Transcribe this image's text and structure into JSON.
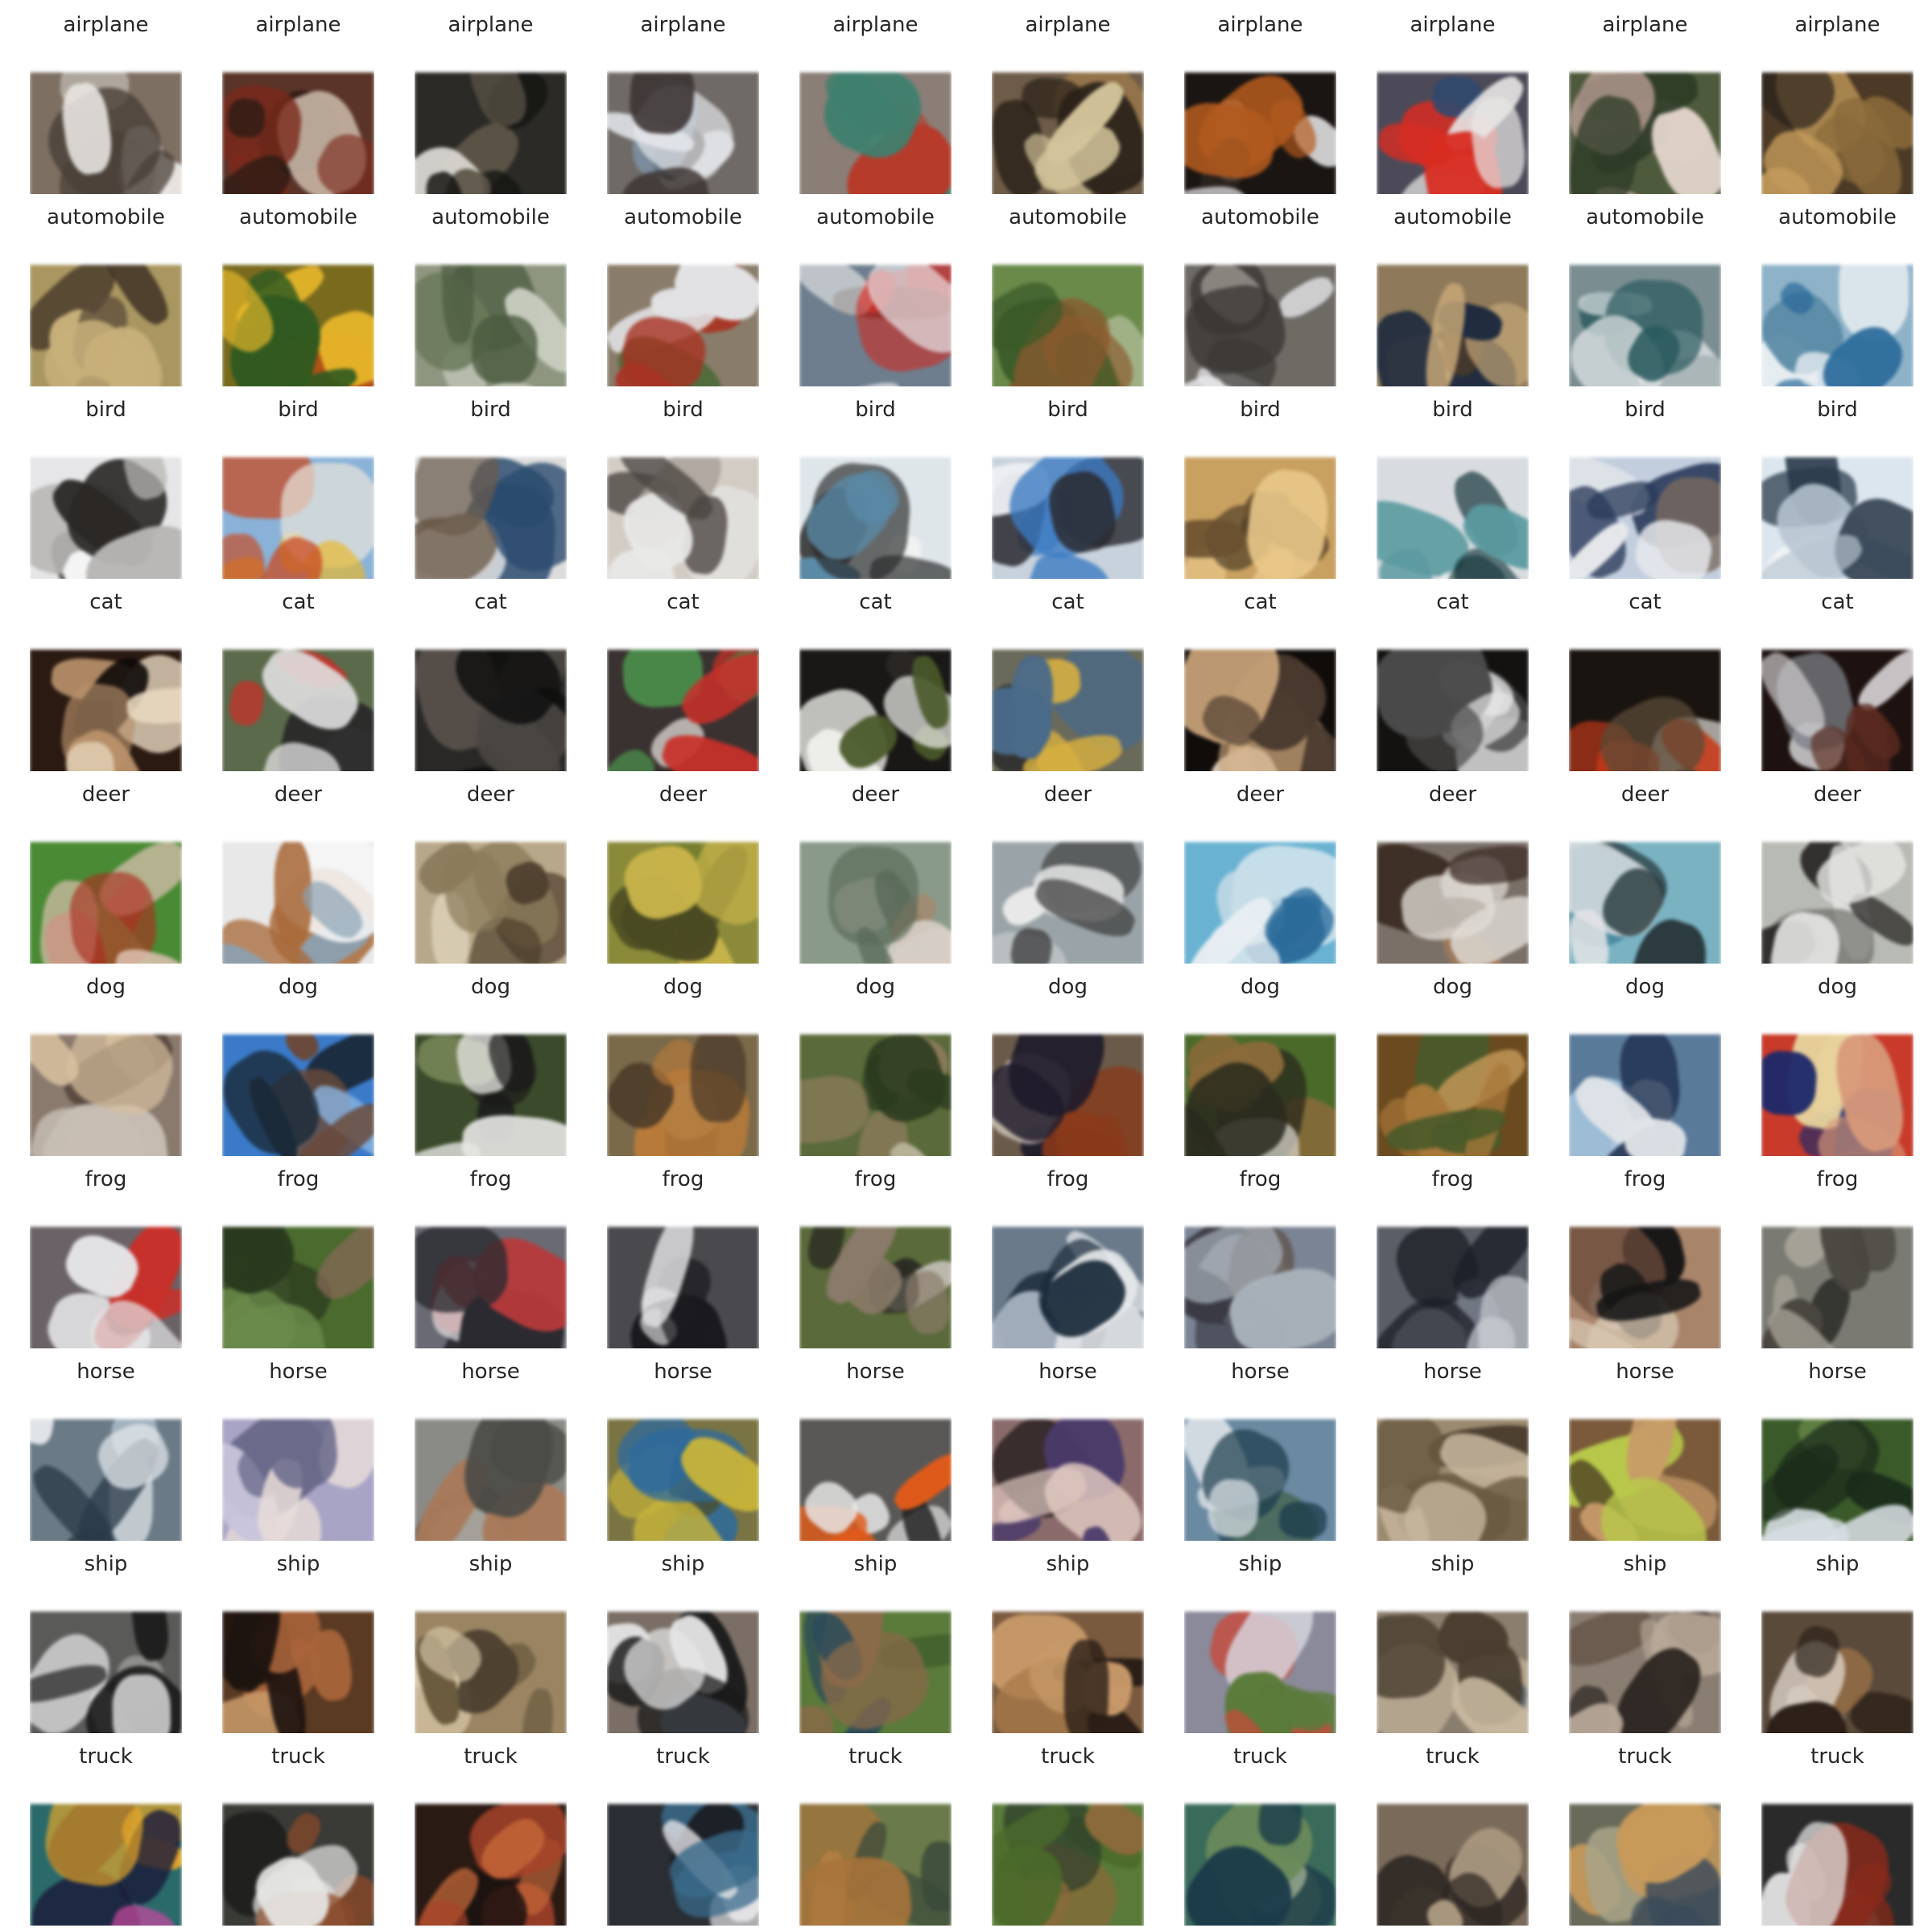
{
  "figure": {
    "rows": [
      {
        "label": "airplane",
        "cells": [
          {
            "label": "airplane",
            "bg": "#7d6f62",
            "c1": "#e8e6e3",
            "c2": "#4a4038",
            "c3": "#b9b2a9"
          },
          {
            "label": "airplane",
            "bg": "#5a3428",
            "c1": "#7a2a1c",
            "c2": "#2e1b14",
            "c3": "#c9b7a6"
          },
          {
            "label": "airplane",
            "bg": "#2b2a26",
            "c1": "#5a5346",
            "c2": "#151412",
            "c3": "#d8d6d0"
          },
          {
            "label": "airplane",
            "bg": "#6f6a66",
            "c1": "#e4e6ea",
            "c2": "#3b3432",
            "c3": "#7f9cb6"
          },
          {
            "label": "airplane",
            "bg": "#8a7e76",
            "c1": "#b83a2a",
            "c2": "#3f7f6e",
            "c3": "#e8e4df"
          },
          {
            "label": "airplane",
            "bg": "#6e5c48",
            "c1": "#2a2119",
            "c2": "#d2c39a",
            "c3": "#9c7a4c"
          },
          {
            "label": "airplane",
            "bg": "#1a1512",
            "c1": "#eeeef0",
            "c2": "#b25a1e",
            "c3": "#2e2420"
          },
          {
            "label": "airplane",
            "bg": "#4c4a58",
            "c1": "#d82c22",
            "c2": "#e8e6e4",
            "c3": "#2f4a6e"
          },
          {
            "label": "airplane",
            "bg": "#4e5a3c",
            "c1": "#c9a9a2",
            "c2": "#2d3b27",
            "c3": "#e0d2c8"
          },
          {
            "label": "airplane",
            "bg": "#4c3a26",
            "c1": "#8a6a3a",
            "c2": "#c29a5a",
            "c3": "#26201a"
          }
        ]
      },
      {
        "label": "automobile",
        "cells": [
          {
            "label": "automobile",
            "bg": "#a99660",
            "c1": "#3a2c22",
            "c2": "#c8b07a",
            "c3": "#5a4a38"
          },
          {
            "label": "automobile",
            "bg": "#7a6a1e",
            "c1": "#e8b82a",
            "c2": "#2f5a20",
            "c3": "#c24a14"
          },
          {
            "label": "automobile",
            "bg": "#8e9680",
            "c1": "#4a5a3e",
            "c2": "#c8ccc0",
            "c3": "#6b7a5a"
          },
          {
            "label": "automobile",
            "bg": "#8a7c6a",
            "c1": "#a83222",
            "c2": "#e2e2e4",
            "c3": "#4e6a3a"
          },
          {
            "label": "automobile",
            "bg": "#6e7e8e",
            "c1": "#c8302a",
            "c2": "#e8e8ea",
            "c3": "#3a3432"
          },
          {
            "label": "automobile",
            "bg": "#6a8a4a",
            "c1": "#8a5a2e",
            "c2": "#3a5a28",
            "c3": "#b8c2a0"
          },
          {
            "label": "automobile",
            "bg": "#6e6a64",
            "c1": "#e6e6e8",
            "c2": "#3a3634",
            "c3": "#a09a92"
          },
          {
            "label": "automobile",
            "bg": "#8e7a5a",
            "c1": "#1e2a3e",
            "c2": "#c8a878",
            "c3": "#4a3a2a"
          },
          {
            "label": "automobile",
            "bg": "#7a8e92",
            "c1": "#e0e4e6",
            "c2": "#2a5a5e",
            "c3": "#a6b2b4"
          },
          {
            "label": "automobile",
            "bg": "#8eb2c8",
            "c1": "#e8eef2",
            "c2": "#2a6a9a",
            "c3": "#5a8aa6"
          }
        ]
      },
      {
        "label": "bird",
        "cells": [
          {
            "label": "bird",
            "bg": "#e6e6e8",
            "c1": "#2a2826",
            "c2": "#b8b6b4",
            "c3": "#f4f4f4"
          },
          {
            "label": "bird",
            "bg": "#8ab2d8",
            "c1": "#e8b82a",
            "c2": "#c84a22",
            "c3": "#e8e4dc"
          },
          {
            "label": "bird",
            "bg": "#dcdcdc",
            "c1": "#2a4a6e",
            "c2": "#6a5a4a",
            "c3": "#f0f0f0"
          },
          {
            "label": "bird",
            "bg": "#d2ccc4",
            "c1": "#e8e8e8",
            "c2": "#4a4440",
            "c3": "#a8a09a"
          },
          {
            "label": "bird",
            "bg": "#dee6ea",
            "c1": "#2a2a2a",
            "c2": "#5a8aa6",
            "c3": "#f2f2f2"
          },
          {
            "label": "bird",
            "bg": "#c8d2dc",
            "c1": "#3a7ac2",
            "c2": "#2a2a30",
            "c3": "#eef0f2"
          },
          {
            "label": "bird",
            "bg": "#c8a060",
            "c1": "#6a5030",
            "c2": "#e8c88a",
            "c3": "#4a3a26"
          },
          {
            "label": "bird",
            "bg": "#d8dce0",
            "c1": "#1a3a3e",
            "c2": "#5a9aa0",
            "c3": "#f0f2f4"
          },
          {
            "label": "bird",
            "bg": "#c2cede",
            "c1": "#2a3a5a",
            "c2": "#e6e8ec",
            "c3": "#7a6a5e"
          },
          {
            "label": "bird",
            "bg": "#dce6ee",
            "c1": "#2a3a4a",
            "c2": "#b8c6d2",
            "c3": "#f2f4f6"
          }
        ]
      },
      {
        "label": "cat",
        "cells": [
          {
            "label": "cat",
            "bg": "#2a1a12",
            "c1": "#b8906a",
            "c2": "#e8d8c0",
            "c3": "#0e0a08"
          },
          {
            "label": "cat",
            "bg": "#5a6a4a",
            "c1": "#c8302a",
            "c2": "#e0e0e0",
            "c3": "#2a2a2a"
          },
          {
            "label": "cat",
            "bg": "#2a2826",
            "c1": "#4a4642",
            "c2": "#0e0e0e",
            "c3": "#6a6258"
          },
          {
            "label": "cat",
            "bg": "#3a3230",
            "c1": "#4a8a4a",
            "c2": "#c8302a",
            "c3": "#e0dcd8"
          },
          {
            "label": "cat",
            "bg": "#1a1816",
            "c1": "#eeeeea",
            "c2": "#4a5a2a",
            "c3": "#2e2a28"
          },
          {
            "label": "cat",
            "bg": "#6a6a5a",
            "c1": "#d8b040",
            "c2": "#4a6a8a",
            "c3": "#2a2a2a"
          },
          {
            "label": "cat",
            "bg": "#100c0a",
            "c1": "#c8a47a",
            "c2": "#4a3a2e",
            "c3": "#e8d8c4"
          },
          {
            "label": "cat",
            "bg": "#141210",
            "c1": "#e6e6e8",
            "c2": "#4a4a4a",
            "c3": "#9a9a9c"
          },
          {
            "label": "cat",
            "bg": "#1a1410",
            "c1": "#c83a1a",
            "c2": "#5a4a36",
            "c3": "#e0dcd6"
          },
          {
            "label": "cat",
            "bg": "#1e1210",
            "c1": "#d8d6d8",
            "c2": "#5a2a1e",
            "c3": "#7a7e86"
          }
        ]
      },
      {
        "label": "deer",
        "cells": [
          {
            "label": "deer",
            "bg": "#4a8a34",
            "c1": "#a83222",
            "c2": "#e0c2b4",
            "c3": "#6aa84a"
          },
          {
            "label": "deer",
            "bg": "#e8e8e8",
            "c1": "#a86a3a",
            "c2": "#8aa2b4",
            "c3": "#f6f6f6"
          },
          {
            "label": "deer",
            "bg": "#b8a88a",
            "c1": "#4a3a2a",
            "c2": "#8a7a5a",
            "c3": "#d8ccb4"
          },
          {
            "label": "deer",
            "bg": "#8a8a3a",
            "c1": "#4a4a22",
            "c2": "#c8b44a",
            "c3": "#6a7a2a"
          },
          {
            "label": "deer",
            "bg": "#8a9a8a",
            "c1": "#d8d0c8",
            "c2": "#5a6a5a",
            "c3": "#a8866a"
          },
          {
            "label": "deer",
            "bg": "#9aa4a8",
            "c1": "#e8e8e8",
            "c2": "#3a3a3a",
            "c3": "#c0c6c8"
          },
          {
            "label": "deer",
            "bg": "#6ab2d2",
            "c1": "#e8eef2",
            "c2": "#2a6a9a",
            "c3": "#c8dce6"
          },
          {
            "label": "deer",
            "bg": "#7a7068",
            "c1": "#3a2a22",
            "c2": "#e0dcd6",
            "c3": "#a07a5a"
          },
          {
            "label": "deer",
            "bg": "#7ab2c2",
            "c1": "#2a3a3e",
            "c2": "#e4e4e6",
            "c3": "#4a8aa0"
          },
          {
            "label": "deer",
            "bg": "#b8bab4",
            "c1": "#2a2826",
            "c2": "#e6e6e4",
            "c3": "#6a6a66"
          }
        ]
      },
      {
        "label": "dog",
        "cells": [
          {
            "label": "dog",
            "bg": "#8a7a6e",
            "c1": "#d8c0a0",
            "c2": "#c8beb4",
            "c3": "#4a3a30"
          },
          {
            "label": "dog",
            "bg": "#3a7ac8",
            "c1": "#1a2a3a",
            "c2": "#6a4a3a",
            "c3": "#8ab6e0"
          },
          {
            "label": "dog",
            "bg": "#3a4a2a",
            "c1": "#e6e6e4",
            "c2": "#1a1a1a",
            "c3": "#7a8a5a"
          },
          {
            "label": "dog",
            "bg": "#7a6a4a",
            "c1": "#b87a3a",
            "c2": "#4a3a28",
            "c3": "#a8a080"
          },
          {
            "label": "dog",
            "bg": "#5a6a3a",
            "c1": "#8a7a5a",
            "c2": "#2a3a1e",
            "c3": "#b8b49a"
          },
          {
            "label": "dog",
            "bg": "#6a5a4a",
            "c1": "#8a3a1a",
            "c2": "#1e1a2a",
            "c3": "#e0d8d0"
          },
          {
            "label": "dog",
            "bg": "#4a6a2a",
            "c1": "#8a6a3a",
            "c2": "#2a2a1e",
            "c3": "#d8d4cc"
          },
          {
            "label": "dog",
            "bg": "#6a4a1e",
            "c1": "#a8783a",
            "c2": "#4a5a2a",
            "c3": "#c89a5a"
          },
          {
            "label": "dog",
            "bg": "#5a7a9a",
            "c1": "#1a2a4a",
            "c2": "#e0e4e8",
            "c3": "#a8c6de"
          },
          {
            "label": "dog",
            "bg": "#c83a2a",
            "c1": "#1e2a6a",
            "c2": "#d89a7a",
            "c3": "#e8d8a0"
          }
        ]
      },
      {
        "label": "frog",
        "cells": [
          {
            "label": "frog",
            "bg": "#6a6266",
            "c1": "#c8302a",
            "c2": "#e6e6e8",
            "c3": "#2a2a2e"
          },
          {
            "label": "frog",
            "bg": "#4a6a2e",
            "c1": "#6a8a4a",
            "c2": "#2a3a1e",
            "c3": "#8a6a5a"
          },
          {
            "label": "frog",
            "bg": "#6a6a74",
            "c1": "#b83a3a",
            "c2": "#2a2a30",
            "c3": "#d8d8dc"
          },
          {
            "label": "frog",
            "bg": "#4a4a4e",
            "c1": "#1a1a1e",
            "c2": "#e0e0e2",
            "c3": "#7a7a80"
          },
          {
            "label": "frog",
            "bg": "#5a6a3a",
            "c1": "#2a2a22",
            "c2": "#8a7a6a",
            "c3": "#c8c4bc"
          },
          {
            "label": "frog",
            "bg": "#6a7a8a",
            "c1": "#e6e8ea",
            "c2": "#1a2a3a",
            "c3": "#a8b4c0"
          },
          {
            "label": "frog",
            "bg": "#7a8494",
            "c1": "#3a3a44",
            "c2": "#a8b0ba",
            "c3": "#5a4a3e"
          },
          {
            "label": "frog",
            "bg": "#5a5e66",
            "c1": "#1a1e26",
            "c2": "#c8ccd2",
            "c3": "#7a8090"
          },
          {
            "label": "frog",
            "bg": "#a8846a",
            "c1": "#141414",
            "c2": "#d8c8b4",
            "c3": "#6a4a3a"
          },
          {
            "label": "frog",
            "bg": "#7a7a72",
            "c1": "#4a4640",
            "c2": "#a8a49a",
            "c3": "#2a2a26"
          }
        ]
      },
      {
        "label": "horse",
        "cells": [
          {
            "label": "horse",
            "bg": "#6a7a86",
            "c1": "#e2e6ea",
            "c2": "#2a3a48",
            "c3": "#a8b8c6"
          },
          {
            "label": "horse",
            "bg": "#a8a4c6",
            "c1": "#e8dcd8",
            "c2": "#6a6a8a",
            "c3": "#c8c4dc"
          },
          {
            "label": "horse",
            "bg": "#8a8a86",
            "c1": "#a87a5a",
            "c2": "#4a4a46",
            "c3": "#c8c6c0"
          },
          {
            "label": "horse",
            "bg": "#7a7444",
            "c1": "#2a6aa0",
            "c2": "#c8b43a",
            "c3": "#4a4a26"
          },
          {
            "label": "horse",
            "bg": "#5a5856",
            "c1": "#e8e8e8",
            "c2": "#e05a1a",
            "c3": "#1a1a1a"
          },
          {
            "label": "horse",
            "bg": "#8a6a6a",
            "c1": "#4a3a6a",
            "c2": "#e0c8c0",
            "c3": "#2a2222"
          },
          {
            "label": "horse",
            "bg": "#6a8aa2",
            "c1": "#1a3a4a",
            "c2": "#d8dee4",
            "c3": "#4a6a5a"
          },
          {
            "label": "horse",
            "bg": "#9a8a6e",
            "c1": "#6a5a42",
            "c2": "#c8b8a0",
            "c3": "#4a3e30"
          },
          {
            "label": "horse",
            "bg": "#7a5a3a",
            "c1": "#c89a6a",
            "c2": "#b8c84a",
            "c3": "#3a2a1e"
          },
          {
            "label": "horse",
            "bg": "#3a5a2a",
            "c1": "#1a2a1a",
            "c2": "#d8dee4",
            "c3": "#6a8a4a"
          }
        ]
      },
      {
        "label": "ship",
        "cells": [
          {
            "label": "ship",
            "bg": "#5a5a58",
            "c1": "#e8e8e8",
            "c2": "#1a1a1a",
            "c3": "#9a9a98"
          },
          {
            "label": "ship",
            "bg": "#5a3a22",
            "c1": "#a8643a",
            "c2": "#1e1410",
            "c3": "#c89a6a"
          },
          {
            "label": "ship",
            "bg": "#9a8462",
            "c1": "#6a5a3e",
            "c2": "#d8c8a8",
            "c3": "#4a3e2e"
          },
          {
            "label": "ship",
            "bg": "#7a6e66",
            "c1": "#1a1a1a",
            "c2": "#e6e6e6",
            "c3": "#8a9aaa"
          },
          {
            "label": "ship",
            "bg": "#5a7a3a",
            "c1": "#2a4a5a",
            "c2": "#8a6a4a",
            "c3": "#3a5a2a"
          },
          {
            "label": "ship",
            "bg": "#7a5a3e",
            "c1": "#c89a6a",
            "c2": "#2a1e16",
            "c3": "#a87a4a"
          },
          {
            "label": "ship",
            "bg": "#8a8a9a",
            "c1": "#c84a3a",
            "c2": "#5a7a3a",
            "c3": "#d8d8e0"
          },
          {
            "label": "ship",
            "bg": "#8a7e6e",
            "c1": "#4a3e30",
            "c2": "#c8b8a0",
            "c3": "#5a6a7a"
          },
          {
            "label": "ship",
            "bg": "#8a7e72",
            "c1": "#2a2420",
            "c2": "#b8a898",
            "c3": "#6a5a4e"
          },
          {
            "label": "ship",
            "bg": "#5a4a3a",
            "c1": "#d8cec4",
            "c2": "#2a1e16",
            "c3": "#a87a4a"
          }
        ]
      },
      {
        "label": "truck",
        "cells": [
          {
            "label": "truck",
            "bg": "#2a6a6a",
            "c1": "#1a1a3a",
            "c2": "#e8a82a",
            "c3": "#c84aa0"
          },
          {
            "label": "truck",
            "bg": "#3a3a36",
            "c1": "#e6e6e4",
            "c2": "#8a4a2a",
            "c3": "#1a1a18"
          },
          {
            "label": "truck",
            "bg": "#2a1a14",
            "c1": "#a8432a",
            "c2": "#c86a3a",
            "c3": "#1a1210"
          },
          {
            "label": "truck",
            "bg": "#2a2e34",
            "c1": "#e6e6e8",
            "c2": "#3a6a8a",
            "c3": "#1a1a1e"
          },
          {
            "label": "truck",
            "bg": "#6a7a4a",
            "c1": "#a8743a",
            "c2": "#3a4a3a",
            "c3": "#c89a5a"
          },
          {
            "label": "truck",
            "bg": "#5a7a3a",
            "c1": "#8a6a3a",
            "c2": "#4a6a2a",
            "c3": "#2a3a2a"
          },
          {
            "label": "truck",
            "bg": "#3a6a5a",
            "c1": "#6a8a5a",
            "c2": "#1a3a4a",
            "c3": "#a8b89a"
          },
          {
            "label": "truck",
            "bg": "#7a6a5a",
            "c1": "#2a2420",
            "c2": "#a8967e",
            "c3": "#4a3e34"
          },
          {
            "label": "truck",
            "bg": "#6a6a5a",
            "c1": "#c89a5a",
            "c2": "#3a4a5a",
            "c3": "#a8a48a"
          },
          {
            "label": "truck",
            "bg": "#2a2a2a",
            "c1": "#e6e6e6",
            "c2": "#8a2a1a",
            "c3": "#5a5a5a"
          }
        ]
      }
    ]
  }
}
